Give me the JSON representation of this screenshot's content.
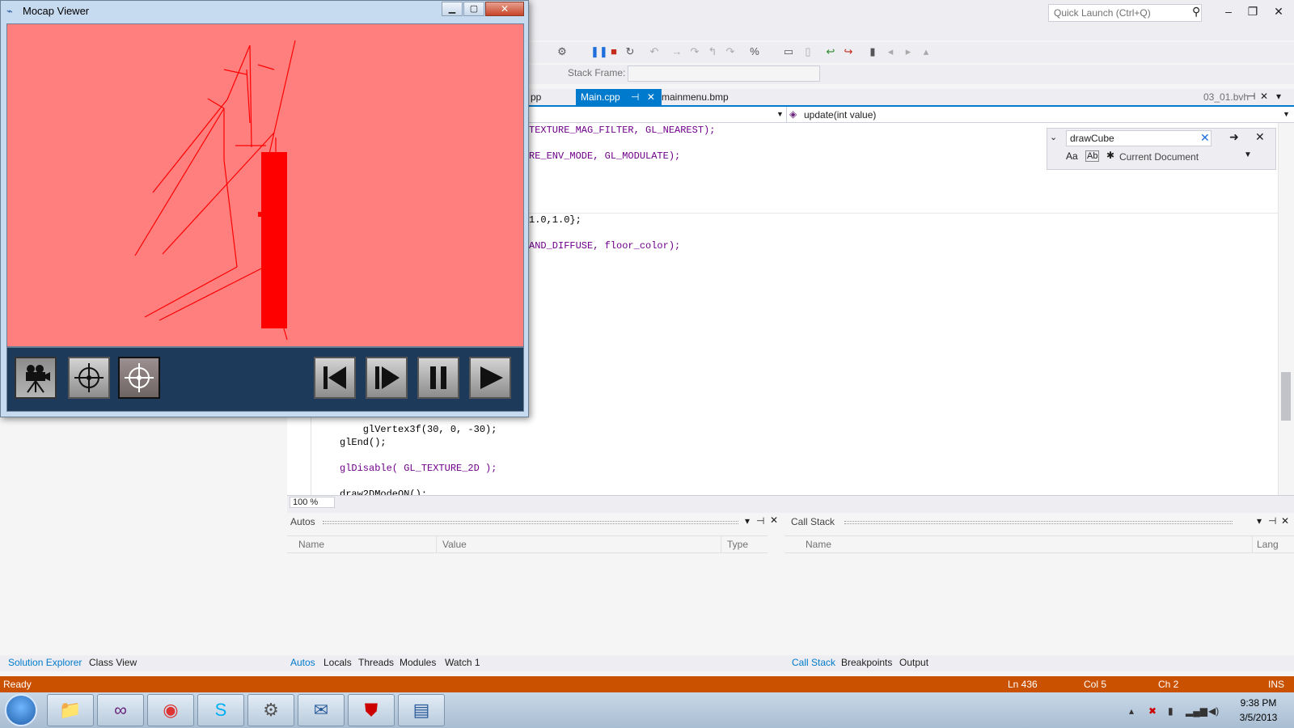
{
  "vs": {
    "quick_launch_placeholder": "Quick Launch (Ctrl+Q)",
    "stack_frame_label": "Stack Frame:",
    "tabs": [
      {
        "label": "pp"
      },
      {
        "label": "Main.cpp"
      },
      {
        "label": "mainmenu.bmp"
      }
    ],
    "right_tab": "03_01.bvh",
    "nav_function": "update(int value)",
    "code_top": [
      "TEXTURE_MAG_FILTER, GL_NEAREST);",
      "RE_ENV_MODE, GL_MODULATE);",
      "1.0,1.0};",
      "AND_DIFFUSE, floor_color);"
    ],
    "code_bottom": [
      "    glVertex3f(30, 0, -30);",
      "glEnd();",
      "glDisable( GL_TEXTURE_2D );",
      "draw2DModeON();"
    ],
    "zoom": "100 %",
    "find": {
      "value": "drawCube",
      "case_label": "Aa",
      "word_label": "Ab",
      "scope": "Current Document"
    }
  },
  "autos": {
    "title": "Autos",
    "columns": [
      "Name",
      "Value",
      "Type"
    ]
  },
  "callstack": {
    "title": "Call Stack",
    "columns": [
      "Name",
      "Lang"
    ]
  },
  "bottom_tabs_left": [
    "Solution Explorer",
    "Class View"
  ],
  "bottom_tabs_mid": [
    "Autos",
    "Locals",
    "Threads",
    "Modules",
    "Watch 1"
  ],
  "bottom_tabs_right": [
    "Call Stack",
    "Breakpoints",
    "Output"
  ],
  "status": {
    "ready": "Ready",
    "ln": "Ln 436",
    "col": "Col 5",
    "ch": "Ch 2",
    "ins": "INS"
  },
  "taskbar": {
    "time": "9:38 PM",
    "date": "3/5/2013"
  },
  "mocap": {
    "title": "Mocap Viewer",
    "bg_color": "#ff7f7f",
    "panel_color": "#1e3a5a",
    "skeleton_color": "#ff0000"
  }
}
